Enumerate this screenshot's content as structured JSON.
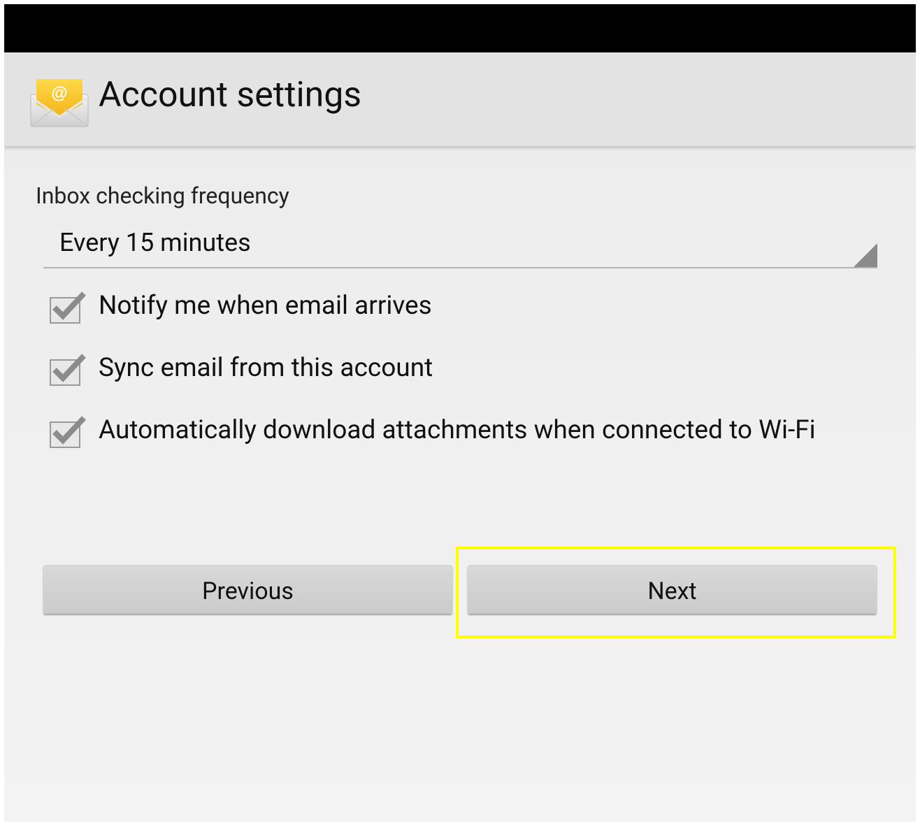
{
  "header": {
    "title": "Account settings",
    "icon": "email-app-icon",
    "icon_symbol": "@"
  },
  "frequency": {
    "label": "Inbox checking frequency",
    "selected": "Every 15 minutes"
  },
  "options": [
    {
      "label": "Notify me when email arrives",
      "checked": true
    },
    {
      "label": "Sync email from this account",
      "checked": true
    },
    {
      "label": "Automatically download attachments when connected to Wi-Fi",
      "checked": true
    }
  ],
  "buttons": {
    "previous": "Previous",
    "next": "Next"
  },
  "colors": {
    "status_bar": "#000000",
    "highlight": "#ffff00",
    "icon_envelope": "#f5c518"
  }
}
